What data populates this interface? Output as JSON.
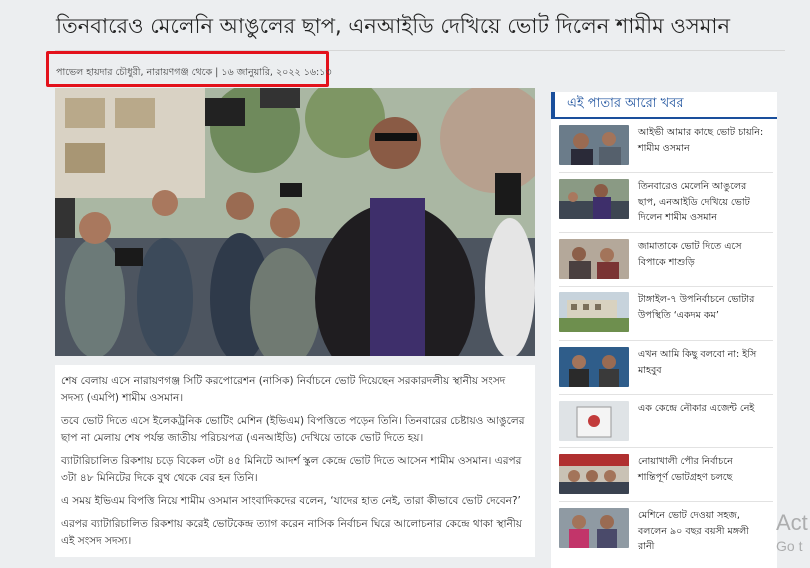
{
  "article": {
    "headline": "তিনবারেও মেলেনি আঙুলের ছাপ, এনআইডি দেখিয়ে ভোট দিলেন শামীম ওসমান",
    "byline": "পাভেল হায়দার চৌধুরী, নারায়ণগঞ্জ থেকে | ১৬ জানুয়ারি, ২০২২ ১৬:১৩",
    "paragraphs": [
      "শেষ বেলায় এসে নারায়ণগঞ্জ সিটি করপোরেশন (নাসিক) নির্বাচনে ভোট দিয়েছেন সরকারদলীয় স্থানীয় সংসদ সদস্য (এমপি) শামীম ওসমান।",
      "তবে ভোট দিতে এসে ইলেকট্রনিক ভোটিং মেশিন (ইভিএম) বিপত্তিতে পড়েন তিনি। তিনবারের চেষ্টায়ও আঙুলের ছাপ না মেলায় শেষ পর্যন্ত জাতীয় পরিচয়পত্র (এনআইডি) দেখিয়ে তাকে ভোট দিতে হয়।",
      "ব্যাটারিচালিত রিকশায় চড়ে বিকেল ৩টা ৪৫ মিনিটে আদর্শ স্কুল কেন্দ্রে ভোট দিতে আসেন শামীম ওসমান। এরপর ৩টা ৪৮ মিনিটের দিকে বুথ থেকে বের হন তিনি।",
      "এ সময় ইভিএম বিপত্তি নিয়ে শামীম ওসমান সাংবাদিকদের বলেন, ‘যাদের হাত নেই, তারা কীভাবে ভোট দেবেন?’",
      "এরপর ব্যাটারিচালিত রিকশায় করেই ভোটকেন্দ্র ত্যাগ করেন নাসিক নির্বাচন ঘিরে আলোচনার কেন্দ্রে থাকা স্থানীয় এই সংসদ সদস্য।"
    ]
  },
  "sidebar": {
    "title": "এই পাতার আরো খবর",
    "items": [
      {
        "l1": "আইভী আমার কাছে ভোট চায়নি:",
        "l2": "শামীম ওসমান",
        "l3": ""
      },
      {
        "l1": "তিনবারেও মেলেনি আঙুলের",
        "l2": "ছাপ, এনআইডি দেখিয়ে ভোট",
        "l3": "দিলেন শামীম ওসমান"
      },
      {
        "l1": "জামাতাকে ভোট দিতে এসে",
        "l2": "বিপাকে শাশুড়ি",
        "l3": ""
      },
      {
        "l1": "টাঙ্গাইল-৭ উপনির্বাচনে ভোটার",
        "l2": "উপস্থিতি ‘একদম কম’",
        "l3": ""
      },
      {
        "l1": "এখন আমি কিছু বলবো না: ইসি",
        "l2": "মাহবুব",
        "l3": ""
      },
      {
        "l1": "এক কেন্দ্রে নৌকার এজেন্ট নেই",
        "l2": "",
        "l3": ""
      },
      {
        "l1": "নোয়াখালী পৌর নির্বাচনে",
        "l2": "শান্তিপূর্ণ ভোটগ্রহণ চলছে",
        "l3": ""
      },
      {
        "l1": "মেশিনে ভোট দেওয়া সহজ,",
        "l2": "বললেন ৯০ বছর বয়সী মঙ্গলী",
        "l3": "রানী"
      }
    ]
  },
  "watermark": {
    "line1": "Act",
    "line2": "Go t"
  },
  "colors": {
    "accent": "#1a4f9c",
    "highlight_box": "#e3111b"
  }
}
